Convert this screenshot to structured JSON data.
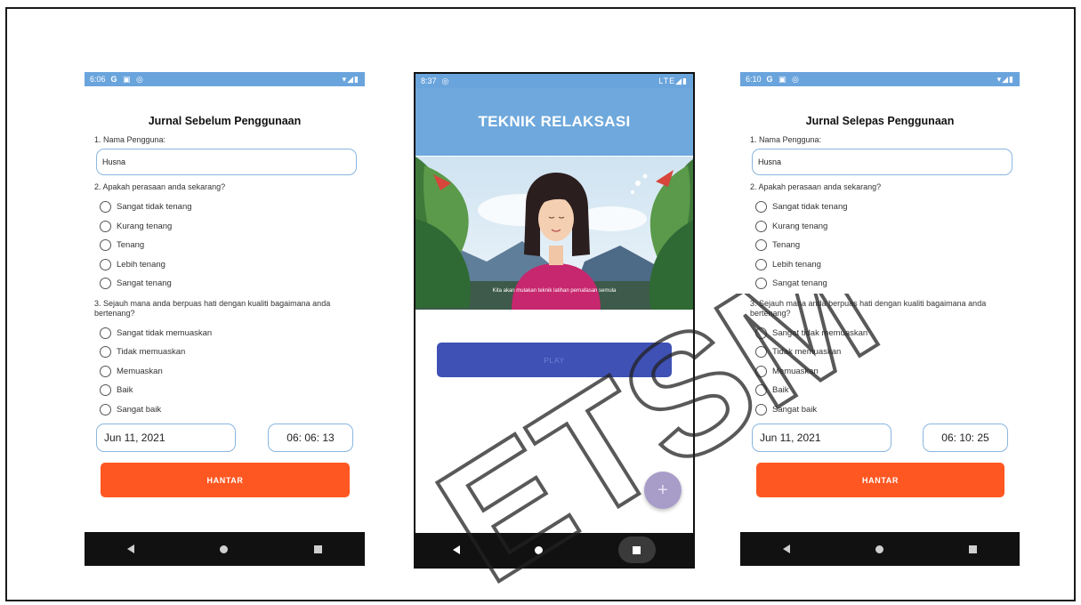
{
  "colors": {
    "statusbar": "#6aa4dc",
    "accent_orange": "#ff5722",
    "play_blue": "#3f51b5",
    "header_blue": "#6ea8dc",
    "field_border": "#8ab6e0",
    "fab": "#a89cc9"
  },
  "screen1": {
    "status_time": "6:06",
    "status_icons": "G ▣ ◎",
    "status_right": "▾◢▮",
    "title": "Jurnal Sebelum Penggunaan",
    "q1": "1. Nama Pengguna:",
    "name_value": "Husna",
    "q2": "2. Apakah perasaan anda sekarang?",
    "q2_options": [
      "Sangat tidak tenang",
      "Kurang tenang",
      "Tenang",
      "Lebih tenang",
      "Sangat tenang"
    ],
    "q3": "3. Sejauh mana anda berpuas hati dengan kualiti bagaimana anda bertenang?",
    "q3_options": [
      "Sangat tidak memuaskan",
      "Tidak memuaskan",
      "Memuaskan",
      "Baik",
      "Sangat baik"
    ],
    "date": "Jun 11, 2021",
    "time": "06: 06: 13",
    "submit_label": "HANTAR"
  },
  "screen2": {
    "status_time": "8:37",
    "status_icons": "◎",
    "status_right": "LTE◢▮",
    "header": "TEKNIK RELAKSASI",
    "caption": "Kita akan mulakan teknik latihan pernafasan semula",
    "play_label": "PLAY",
    "fab_icon": "+"
  },
  "screen3": {
    "status_time": "6:10",
    "status_icons": "G ▣ ◎",
    "status_right": "▾◢▮",
    "title": "Jurnal Selepas Penggunaan",
    "q1": "1. Nama Pengguna:",
    "name_value": "Husna",
    "q2": "2. Apakah perasaan anda sekarang?",
    "q2_options": [
      "Sangat tidak tenang",
      "Kurang tenang",
      "Tenang",
      "Lebih tenang",
      "Sangat tenang"
    ],
    "q3": "3. Sejauh mana anda berpuas hati dengan kualiti bagaimana anda bertenang?",
    "q3_options": [
      "Sangat tidak memuaskan",
      "Tidak memuaskan",
      "Memuaskan",
      "Baik",
      "Sangat baik"
    ],
    "date": "Jun 11, 2021",
    "time": "06: 10: 25",
    "submit_label": "HANTAR"
  },
  "watermark": "ETSM"
}
